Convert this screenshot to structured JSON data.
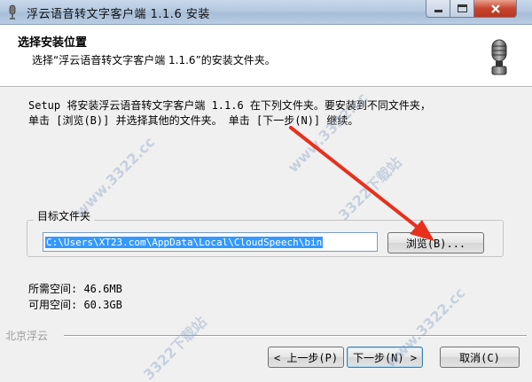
{
  "window": {
    "title": "浮云语音转文字客户端 1.1.6 安装"
  },
  "header": {
    "title": "选择安装位置",
    "subtitle": "选择“浮云语音转文字客户端 1.1.6”的安装文件夹。"
  },
  "body": {
    "description_line1": "Setup 将安装浮云语音转文字客户端 1.1.6 在下列文件夹。要安装到不同文件夹，",
    "description_line2": "单击 [浏览(B)] 并选择其他的文件夹。 单击 [下一步(N)] 继续。",
    "target_folder_label": "目标文件夹",
    "install_path": "C:\\Users\\XT23.com\\AppData\\Local\\CloudSpeech\\bin",
    "browse_label": "浏览(B)...",
    "space_required": "所需空间: 46.6MB",
    "space_available": "可用空间: 60.3GB"
  },
  "footer": {
    "brand": "北京浮云",
    "back_label": "< 上一步(P)",
    "next_label": "下一步(N) >",
    "cancel_label": "取消(C)"
  },
  "watermarks": {
    "text1": "www.3322.cc",
    "text2": "3322下载站"
  },
  "icons": {
    "app": "microphone-icon",
    "header": "microphone-icon",
    "annotation": "red-arrow"
  },
  "colors": {
    "selection": "#3399ff",
    "arrow": "#e8301c",
    "close_button": "#c8452f"
  }
}
